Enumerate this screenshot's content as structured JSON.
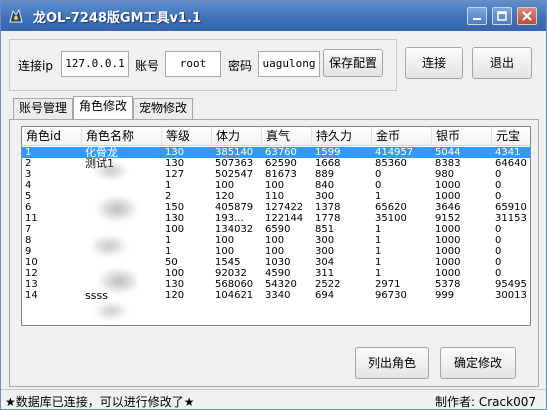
{
  "window": {
    "title": "龙OL-7248版GM工具v1.1",
    "icon": "dragon-app-icon",
    "controls": [
      "minimize-icon",
      "maximize-icon",
      "close-icon"
    ]
  },
  "connection": {
    "ip_label": "连接ip",
    "ip_value": "127.0.0.1",
    "account_label": "账号",
    "account_value": "root",
    "password_label": "密码",
    "password_value": "uagulong",
    "save_config_label": "保存配置",
    "connect_label": "连接",
    "exit_label": "退出"
  },
  "tabs": [
    {
      "label": "账号管理",
      "active": false
    },
    {
      "label": "角色修改",
      "active": true
    },
    {
      "label": "宠物修改",
      "active": false
    }
  ],
  "table": {
    "columns": [
      "角色id",
      "角色名称",
      "等级",
      "体力",
      "真气",
      "持久力",
      "金币",
      "银币",
      "元宝"
    ],
    "rows": [
      {
        "id": "1",
        "name": "化骨龙",
        "level": "130",
        "hp": "385140",
        "mp": "63760",
        "endurance": "1599",
        "gold": "414957",
        "silver": "5044",
        "yuanbao": "4341",
        "selected": true
      },
      {
        "id": "2",
        "name": "测试1",
        "level": "130",
        "hp": "507363",
        "mp": "62590",
        "endurance": "1668",
        "gold": "85360",
        "silver": "8383",
        "yuanbao": "64640",
        "selected": false
      },
      {
        "id": "3",
        "name": "",
        "level": "127",
        "hp": "502547",
        "mp": "81673",
        "endurance": "889",
        "gold": "0",
        "silver": "980",
        "yuanbao": "0",
        "selected": false
      },
      {
        "id": "4",
        "name": "",
        "level": "1",
        "hp": "100",
        "mp": "100",
        "endurance": "840",
        "gold": "0",
        "silver": "1000",
        "yuanbao": "0",
        "selected": false
      },
      {
        "id": "5",
        "name": "",
        "level": "2",
        "hp": "120",
        "mp": "110",
        "endurance": "300",
        "gold": "1",
        "silver": "1000",
        "yuanbao": "0",
        "selected": false
      },
      {
        "id": "6",
        "name": "",
        "level": "150",
        "hp": "405879",
        "mp": "127422",
        "endurance": "1378",
        "gold": "65620",
        "silver": "3646",
        "yuanbao": "65910",
        "selected": false
      },
      {
        "id": "11",
        "name": "",
        "level": "130",
        "hp": "193...",
        "mp": "122144",
        "endurance": "1778",
        "gold": "35100",
        "silver": "9152",
        "yuanbao": "31153",
        "selected": false
      },
      {
        "id": "7",
        "name": "",
        "level": "100",
        "hp": "134032",
        "mp": "6590",
        "endurance": "851",
        "gold": "1",
        "silver": "1000",
        "yuanbao": "0",
        "selected": false
      },
      {
        "id": "8",
        "name": "",
        "level": "1",
        "hp": "100",
        "mp": "100",
        "endurance": "300",
        "gold": "1",
        "silver": "1000",
        "yuanbao": "0",
        "selected": false
      },
      {
        "id": "9",
        "name": "",
        "level": "1",
        "hp": "100",
        "mp": "100",
        "endurance": "300",
        "gold": "1",
        "silver": "1000",
        "yuanbao": "0",
        "selected": false
      },
      {
        "id": "10",
        "name": "",
        "level": "50",
        "hp": "1545",
        "mp": "1030",
        "endurance": "304",
        "gold": "1",
        "silver": "1000",
        "yuanbao": "0",
        "selected": false
      },
      {
        "id": "12",
        "name": "",
        "level": "100",
        "hp": "92032",
        "mp": "4590",
        "endurance": "311",
        "gold": "1",
        "silver": "1000",
        "yuanbao": "0",
        "selected": false
      },
      {
        "id": "13",
        "name": "",
        "level": "130",
        "hp": "568060",
        "mp": "54320",
        "endurance": "2522",
        "gold": "2971",
        "silver": "5378",
        "yuanbao": "95495",
        "selected": false
      },
      {
        "id": "14",
        "name": "ssss",
        "level": "120",
        "hp": "104621",
        "mp": "3340",
        "endurance": "694",
        "gold": "96730",
        "silver": "999",
        "yuanbao": "30013",
        "selected": false
      }
    ]
  },
  "actions": {
    "list_roles_label": "列出角色",
    "confirm_edit_label": "确定修改"
  },
  "status": {
    "left_text": "★数据库已连接，可以进行修改了★",
    "right_text": "制作者: Crack007"
  },
  "colors": {
    "title_bar": "#3f6fb6",
    "selection": "#3399ff",
    "window_bg": "#f0f0f0"
  }
}
